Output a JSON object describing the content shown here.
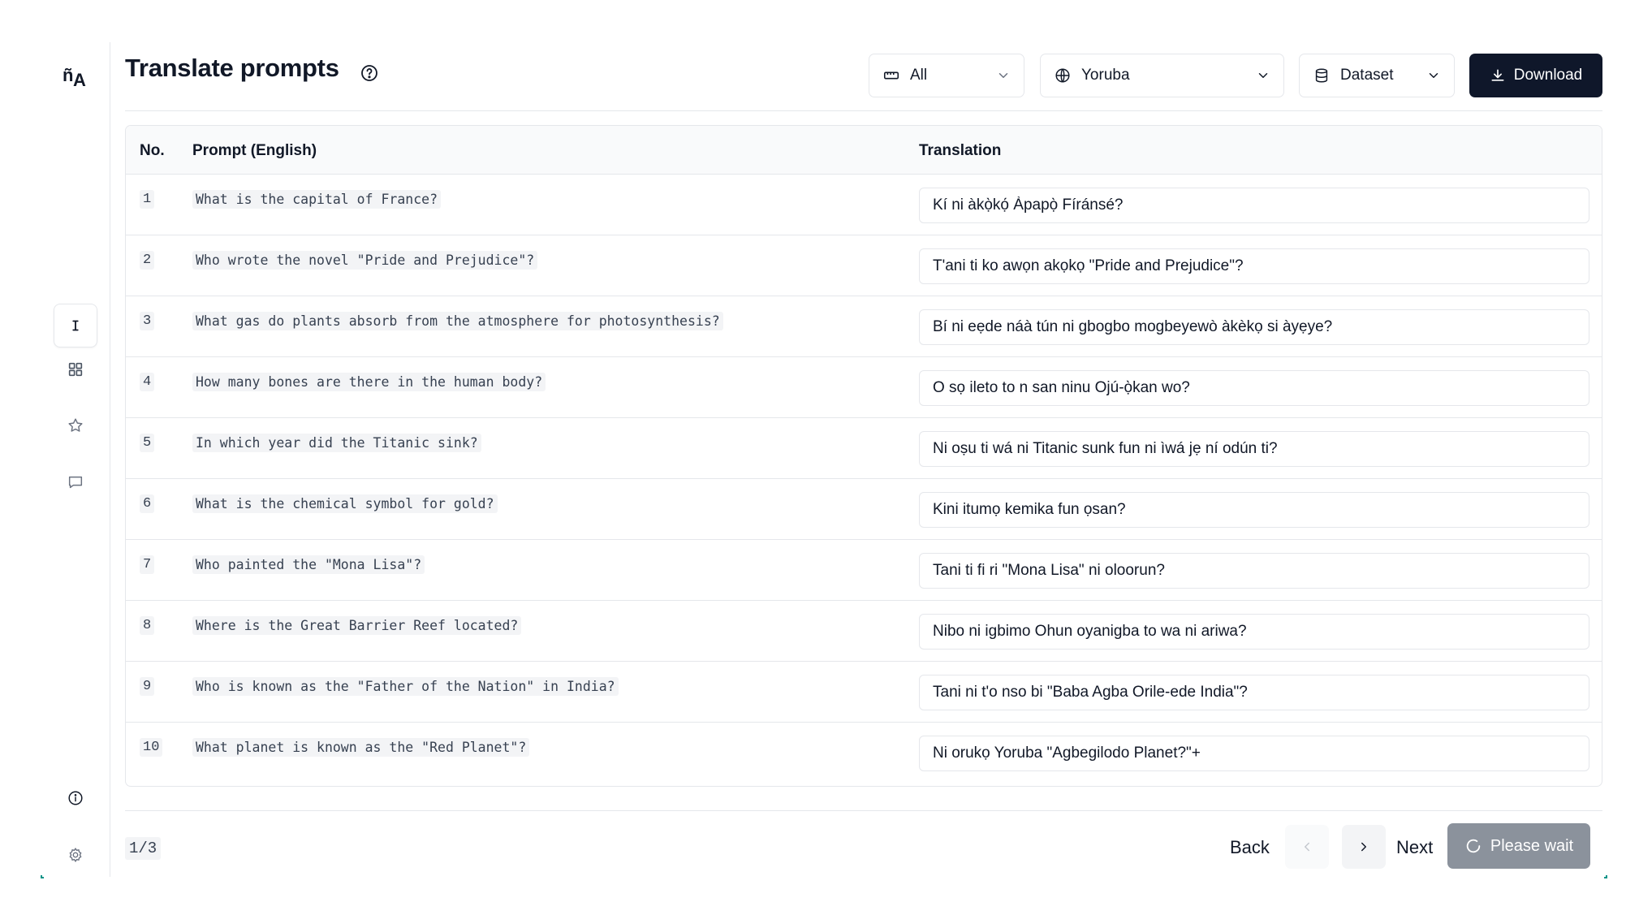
{
  "header": {
    "title": "Translate prompts",
    "filter_all": "All",
    "language": "Yoruba",
    "dataset": "Dataset",
    "download": "Download"
  },
  "sidebar": {
    "items": [
      {
        "name": "text-cursor-icon",
        "active": true
      },
      {
        "name": "grid-icon",
        "active": false
      },
      {
        "name": "star-icon",
        "active": false
      },
      {
        "name": "message-icon",
        "active": false
      },
      {
        "name": "info-icon",
        "active": false
      },
      {
        "name": "gear-icon",
        "active": false
      }
    ]
  },
  "table": {
    "columns": {
      "no": "No.",
      "prompt": "Prompt (English)",
      "translation": "Translation"
    },
    "rows": [
      {
        "no": "1",
        "prompt": "What is the capital of France?",
        "translation": "Kí ni àkọ̀kọ́ Àpapọ̀ Fíránsé?"
      },
      {
        "no": "2",
        "prompt": "Who wrote the novel \"Pride and Prejudice\"?",
        "translation": "T'ani ti ko awọn akọkọ \"Pride and Prejudice\"?"
      },
      {
        "no": "3",
        "prompt": "What gas do plants absorb from the atmosphere for photosynthesis?",
        "translation": "Bí ni eẹde náà tún ni gbogbo mogbeyewò àkèkọ si àyẹye?"
      },
      {
        "no": "4",
        "prompt": "How many bones are there in the human body?",
        "translation": "O sọ ileto to n san ninu Ojú-ọ̀kan wo?"
      },
      {
        "no": "5",
        "prompt": "In which year did the Titanic sink?",
        "translation": "Ni oṣu ti wá ni Titanic sunk fun ni ìwá jẹ ní odún ti?"
      },
      {
        "no": "6",
        "prompt": "What is the chemical symbol for gold?",
        "translation": "Kini itumọ kemika fun ọsan?"
      },
      {
        "no": "7",
        "prompt": "Who painted the \"Mona Lisa\"?",
        "translation": "Tani ti fi ri \"Mona Lisa\" ni oloorun?"
      },
      {
        "no": "8",
        "prompt": "Where is the Great Barrier Reef located?",
        "translation": "Nibo ni igbimo Ohun oyanigba to wa ni ariwa?"
      },
      {
        "no": "9",
        "prompt": "Who is known as the \"Father of the Nation\" in India?",
        "translation": "Tani ni t'o nso bi \"Baba Agba Orile-ede India\"?"
      },
      {
        "no": "10",
        "prompt": "What planet is known as the \"Red Planet\"?",
        "translation": "Ni orukọ Yoruba \"Agbegilodo Planet?\"+"
      }
    ]
  },
  "footer": {
    "page_indicator": "1/3",
    "back": "Back",
    "next": "Next",
    "wait": "Please wait"
  },
  "colors": {
    "primary": "#0f172a",
    "disabled": "#8b929c",
    "border": "#e5e7eb"
  }
}
